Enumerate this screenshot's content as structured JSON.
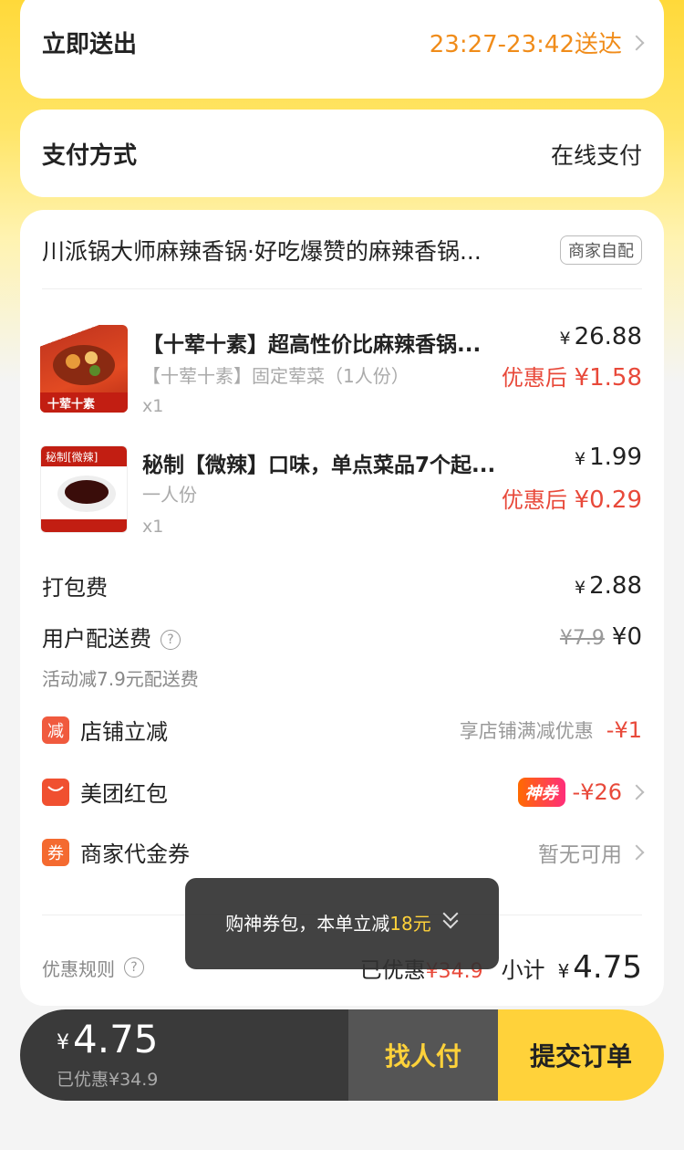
{
  "delivery": {
    "label": "立即送出",
    "time": "23:27-23:42送达"
  },
  "payment": {
    "label": "支付方式",
    "value": "在线支付"
  },
  "shop": {
    "name": "川派锅大师麻辣香锅·好吃爆赞的麻辣香锅...",
    "tag": "商家自配"
  },
  "items": [
    {
      "name": "【十荤十素】超高性价比麻辣香锅...",
      "sub": "【十荤十素】固定荤菜（1人份）",
      "qty": "x1",
      "yen": "¥",
      "price": "26.88",
      "disc_prefix": "优惠后",
      "disc_price": "¥1.58",
      "img_text": "十荤十素"
    },
    {
      "name": "秘制【微辣】口味，单点菜品7个起...",
      "sub": "一人份",
      "qty": "x1",
      "yen": "¥",
      "price": "1.99",
      "disc_prefix": "优惠后",
      "disc_price": "¥0.29",
      "img_text": "秘制[微辣]"
    }
  ],
  "fees": {
    "packing": {
      "label": "打包费",
      "yen": "¥",
      "value": "2.88"
    },
    "delivery": {
      "label": "用户配送费",
      "help": "?",
      "orig": "¥7.9",
      "value": "¥0",
      "note": "活动减7.9元配送费"
    }
  },
  "discounts": [
    {
      "icon": "减",
      "label": "店铺立减",
      "desc": "享店铺满减优惠",
      "value": "-¥1"
    },
    {
      "icon": "",
      "label": "美团红包",
      "badge": "神券",
      "value": "-¥26"
    },
    {
      "icon": "券",
      "label": "商家代金券",
      "value": "暂无可用"
    }
  ],
  "summary": {
    "rules": "优惠规则",
    "help": "?",
    "saved_label": "已优惠",
    "saved": "¥34.9",
    "subtotal_label": "小计",
    "yen": "¥",
    "subtotal": "4.75"
  },
  "toast": {
    "text": "购神券包，本单立减",
    "highlight": "18元"
  },
  "bottom": {
    "yen": "¥",
    "total": "4.75",
    "saved": "已优惠¥34.9",
    "pay_for_me": "找人付",
    "submit": "提交订单"
  },
  "colors": {
    "brand_yellow": "#ffd23a",
    "discount_red": "#e8493a",
    "time_orange": "#f08c1a"
  }
}
